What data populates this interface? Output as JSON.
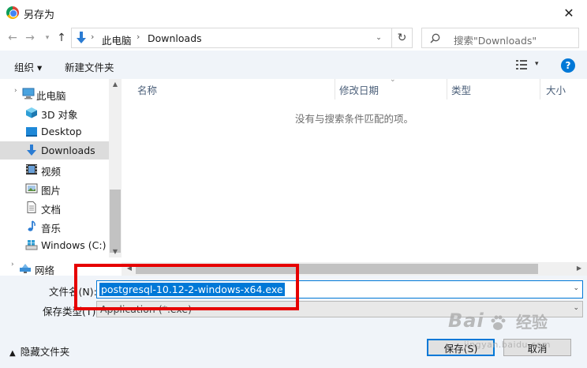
{
  "window": {
    "title": "另存为"
  },
  "nav": {
    "path": [
      "此电脑",
      "Downloads"
    ],
    "search_placeholder": "搜索\"Downloads\""
  },
  "toolbar": {
    "organize": "组织 ▾",
    "new_folder": "新建文件夹"
  },
  "sidebar": {
    "items": [
      {
        "label": "此电脑",
        "icon": "computer-icon"
      },
      {
        "label": "3D 对象",
        "icon": "3d-objects-icon"
      },
      {
        "label": "Desktop",
        "icon": "desktop-icon"
      },
      {
        "label": "Downloads",
        "icon": "downloads-icon",
        "selected": true
      },
      {
        "label": "视频",
        "icon": "video-icon"
      },
      {
        "label": "图片",
        "icon": "pictures-icon"
      },
      {
        "label": "文档",
        "icon": "documents-icon"
      },
      {
        "label": "音乐",
        "icon": "music-icon"
      },
      {
        "label": "Windows (C:)",
        "icon": "drive-icon"
      }
    ],
    "network": {
      "label": "网络",
      "icon": "network-icon"
    }
  },
  "columns": [
    "名称",
    "修改日期",
    "类型",
    "大小"
  ],
  "empty_message": "没有与搜索条件匹配的项。",
  "form": {
    "filename_label": "文件名(N):",
    "filename_value": "postgresql-10.12-2-windows-x64.exe",
    "filetype_label": "保存类型(T):",
    "filetype_value": "Application (*.exe)"
  },
  "footer": {
    "hide_folders": "隐藏文件夹",
    "save": "保存(S)",
    "cancel": "取消"
  },
  "watermark": {
    "logo": "Bai",
    "cn": "经验",
    "url": "jingyan.baidu.com"
  },
  "colors": {
    "accent": "#0078d7",
    "annotation": "#e60000",
    "toolbar_bg": "#f0f4f9"
  }
}
